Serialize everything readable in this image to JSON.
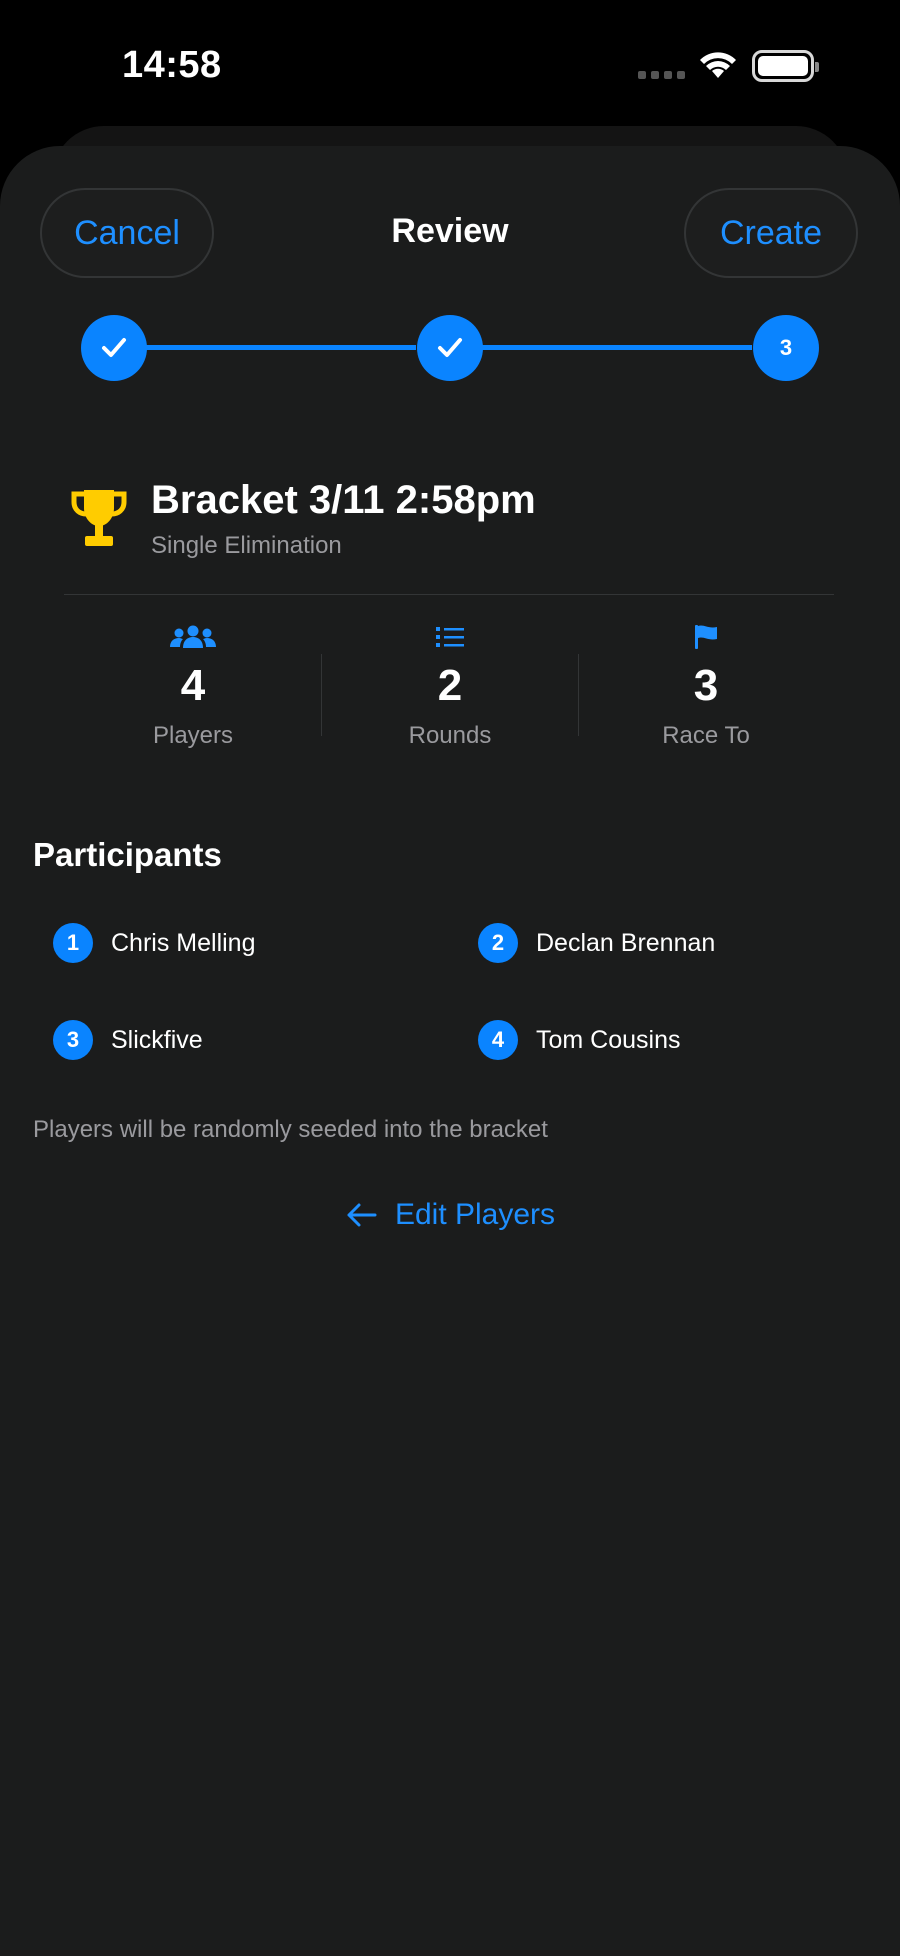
{
  "status_bar": {
    "time": "14:58"
  },
  "nav": {
    "cancel_label": "Cancel",
    "title": "Review",
    "create_label": "Create"
  },
  "stepper": {
    "steps": [
      {
        "state": "done"
      },
      {
        "state": "done"
      },
      {
        "state": "current",
        "label": "3"
      }
    ]
  },
  "bracket": {
    "title": "Bracket 3/11 2:58pm",
    "format": "Single Elimination",
    "icon": "trophy-icon"
  },
  "stats": [
    {
      "icon": "people-icon",
      "value": "4",
      "label": "Players"
    },
    {
      "icon": "list-icon",
      "value": "2",
      "label": "Rounds"
    },
    {
      "icon": "flag-icon",
      "value": "3",
      "label": "Race To"
    }
  ],
  "participants": {
    "title": "Participants",
    "items": [
      {
        "seed": "1",
        "name": "Chris Melling"
      },
      {
        "seed": "2",
        "name": "Declan Brennan"
      },
      {
        "seed": "3",
        "name": "Slickfive"
      },
      {
        "seed": "4",
        "name": "Tom Cousins"
      }
    ]
  },
  "note": "Players will be randomly seeded into the bracket",
  "edit_players_label": "Edit Players",
  "colors": {
    "accent": "#0a84ff",
    "trophy": "#ffcc00",
    "background": "#1b1c1c",
    "secondary_text": "#9a9a9e"
  }
}
